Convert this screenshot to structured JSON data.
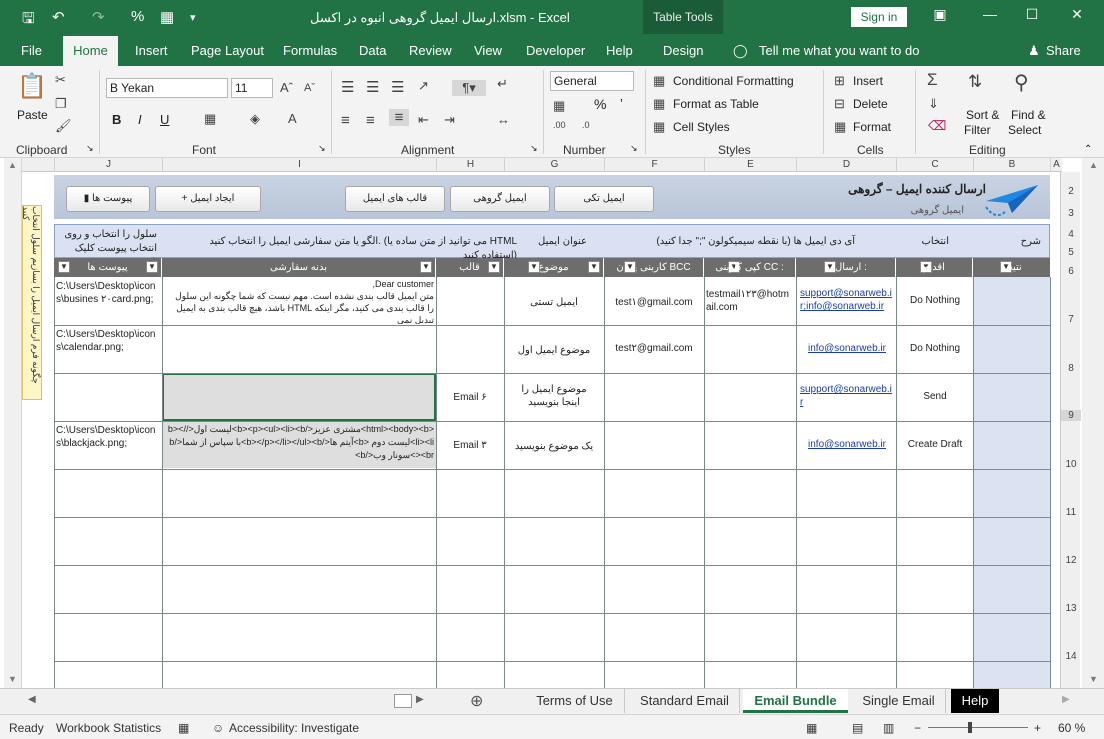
{
  "titlebar": {
    "title": "ارسال ایمیل گروهی انبوه در اکسل.xlsm  -  Excel",
    "context_tab": "Table Tools",
    "signin": "Sign in",
    "percent_glyph": "%"
  },
  "ribbon_tabs": [
    "File",
    "Home",
    "Insert",
    "Page Layout",
    "Formulas",
    "Data",
    "Review",
    "View",
    "Developer",
    "Help",
    "Design"
  ],
  "tell_me": "Tell me what you want to do",
  "share": "Share",
  "ribbon": {
    "paste": "Paste",
    "font_name": "B Yekan",
    "font_size": "11",
    "bold": "B",
    "italic": "I",
    "underline": "U",
    "number_format": "General",
    "percent": "%",
    "conditional_formatting": "Conditional Formatting",
    "format_as_table": "Format as Table",
    "cell_styles": "Cell Styles",
    "insert": "Insert",
    "delete": "Delete",
    "format": "Format",
    "sort_filter": "Sort &",
    "sort_filter2": "Filter",
    "find_select": "Find &",
    "find_select2": "Select",
    "groups": {
      "clipboard": "Clipboard",
      "font": "Font",
      "alignment": "Alignment",
      "number": "Number",
      "styles": "Styles",
      "cells": "Cells",
      "editing": "Editing"
    }
  },
  "columns": [
    "J",
    "I",
    "H",
    "G",
    "F",
    "E",
    "D",
    "C",
    "B",
    "A"
  ],
  "rows": [
    "2",
    "3",
    "4",
    "5",
    "6",
    "7",
    "8",
    "9",
    "10",
    "11",
    "12",
    "13",
    "14"
  ],
  "band": {
    "title": "ارسال کننده ایمیل – گروهی",
    "subtitle": "ایمیل گروهی",
    "btn_single": "ایمیل تکی",
    "btn_group": "ایمیل گروهی",
    "btn_templates": "قالب های ایمیل",
    "btn_create": "+ ایجاد ایمیل",
    "btn_attach": "پیوست ها"
  },
  "description": {
    "sharh": "شرح",
    "entekhab": "انتخاب",
    "ids": "آی دی ایمیل ها (با نقطه سیمیکولون \";\" جدا کنید)",
    "subject_title": "عنوان ایمیل",
    "pattern": "الگو یا متن سفارشی ایمیل را انتخاب کنید. (می توانید از متن ساده یا HTML استفاده کنید)",
    "attach_hint1": "سلول را انتخاب و روی",
    "attach_hint2": "انتخاب پیوست کلیک کنید."
  },
  "headers": {
    "result": "نتیجه",
    "action": "اقدام",
    "send_to": "ارسال به :",
    "cc": "کپی کاربنی CC :",
    "bcc": "کاربنی پنهان BCC",
    "subject": "موضوع",
    "template": "قالب",
    "body": "بدنه سفارشی",
    "attachments": "پیوست ها"
  },
  "table_rows": [
    {
      "action": "Do Nothing",
      "to": "support@sonarweb.ir;info@sonarweb.ir",
      "cc": "testmail۱۲۳@hotmail.com",
      "bcc": "test۱@gmail.com",
      "subject": "ایمیل تستی",
      "template": "",
      "body": "Dear customer,\nمتن ایمیل قالب بندی نشده است. مهم نیست که شما چگونه این سلول را قالب بندی می کنید، مگر اینکه HTML باشد، هیچ قالب بندی به ایمیل تبدیل نمی",
      "attach": "C:\\Users\\Desktop\\icons\\busines ۲۰card.png;"
    },
    {
      "action": "Do Nothing",
      "to": "info@sonarweb.ir",
      "cc": "",
      "bcc": "test۲@gmail.com",
      "subject": "موضوع ایمیل اول",
      "template": "",
      "body": "",
      "attach": "C:\\Users\\Desktop\\icons\\calendar.png;"
    },
    {
      "action": "Send",
      "to": "support@sonarweb.ir",
      "cc": "",
      "bcc": "",
      "subject": "موضوع ایمیل را اینجا بنویسید",
      "template": "Email ۶",
      "body": "",
      "attach": ""
    },
    {
      "action": "Create Draft",
      "to": "info@sonarweb.ir",
      "cc": "",
      "bcc": "",
      "subject": "یک موضوع بنویسید",
      "template": "Email ۳",
      "body": "<html><body><b>مشتری عزیز</b><p><ul><li><b>لیست اول</b></li><li>لیست دوم <b>آیتم ها</b></p></li></ul><b>با سپاس از شما</b><br>سونار وب</b>",
      "attach": "C:\\Users\\Desktop\\icons\\blackjack.png;"
    }
  ],
  "left_panel": "چگونه فرم ارسال ایمیل را بسازیم سلول انتخاب کنید",
  "sheet_tabs": [
    "Terms of Use",
    "Standard Email",
    "Email Bundle",
    "Single Email",
    "Help"
  ],
  "active_sheet": "Email Bundle",
  "status": {
    "ready": "Ready",
    "workbook_stats": "Workbook Statistics",
    "accessibility": "Accessibility: Investigate",
    "zoom": "60 %"
  }
}
